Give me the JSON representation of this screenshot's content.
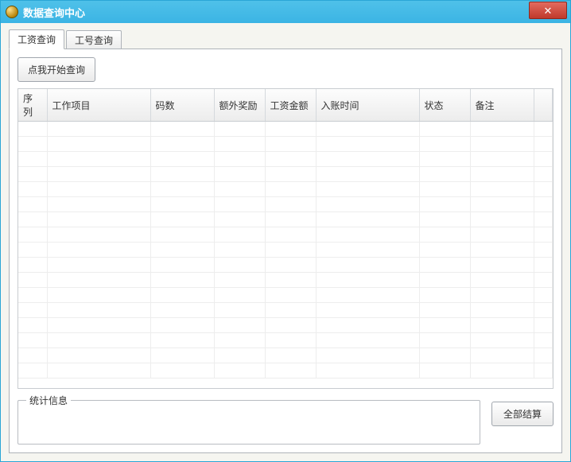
{
  "window": {
    "title": "数据查询中心"
  },
  "tabs": {
    "salary": "工资查询",
    "jobno": "工号查询"
  },
  "buttons": {
    "start_query": "点我开始查询",
    "settle_all": "全部结算"
  },
  "table": {
    "headers": {
      "seq": "序列",
      "project": "工作项目",
      "code": "码数",
      "bonus": "额外奖励",
      "amount": "工资金额",
      "time": "入账时间",
      "status": "状态",
      "remark": "备注"
    }
  },
  "groupbox": {
    "stats_legend": "统计信息"
  }
}
